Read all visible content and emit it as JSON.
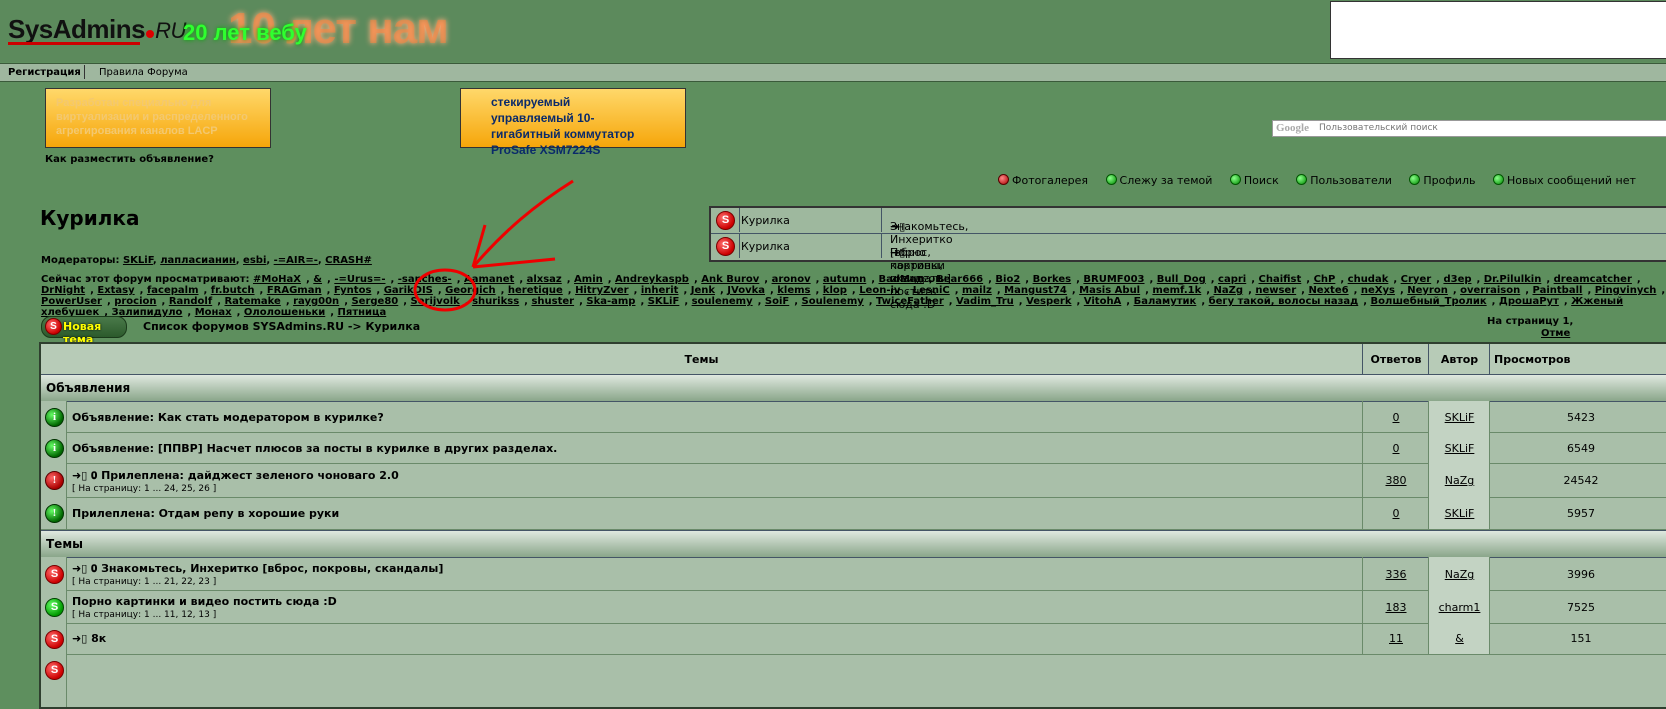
{
  "header": {
    "logo_main": "SysAdmins",
    "logo_suffix": "RU",
    "slogan": "20 лет вебу",
    "anniversary": "10 лет нам"
  },
  "topnav": {
    "register": "Регистрация",
    "rules": "Правила Форума"
  },
  "banners": {
    "left_text": "Разработан специально для виртуализации и распределенного агрегирования каналов LACP",
    "right_text": "стекируемый управляемый 10-гигабитный коммутатор ProSafe XSM7224S",
    "ad_link": "Как разместить объявление?"
  },
  "search": {
    "brand": "Google",
    "placeholder": "Пользовательский поиск"
  },
  "quicklinks": [
    "Фотогалерея",
    "Слежу за темой",
    "Поиск",
    "Пользователи",
    "Профиль",
    "Новых сообщений нет"
  ],
  "forum_title": "Курилка",
  "mini_topics": [
    {
      "forum": "Курилка",
      "title": "Знакомьтесь, Инхеритко [вброс, покровы, скандалы]"
    },
    {
      "forum": "Курилка",
      "title": "Порно картинки и видео постить сюда :D"
    }
  ],
  "moderators": {
    "label": "Модераторы:",
    "names": [
      "SKLiF",
      "лапласианин",
      "esbi",
      "-=AIR=-",
      "CRASH#"
    ]
  },
  "viewers": {
    "label": "Сейчас этот форум просматривают:",
    "names": [
      "#MoHaX",
      "&",
      "-=Urus=-",
      "-sanches-",
      "Aamanet",
      "alxsaz",
      "Amin",
      "Andreykaspb",
      "Ank Burov",
      "aronov",
      "autumn",
      "BadMan",
      "Bear666",
      "Bio2",
      "Borkes",
      "BRUMF003",
      "Bull_Dog",
      "capri",
      "Chaifist",
      "ChP",
      "chudak",
      "Cryer",
      "d3ep",
      "Dr.Pilulkin",
      "dreamcatcher",
      "DrNight",
      "Extasy",
      "facepalm",
      "fr.butch",
      "FRAGman",
      "Fyntos",
      "GarikDIS",
      "Georgich",
      "heretique",
      "HitryZver",
      "inherit",
      "Jenk",
      "JVovka",
      "klems",
      "klop",
      "Leon-iv",
      "LesniC",
      "mailz",
      "Mangust74",
      "Masis Abul",
      "memf.1k",
      "NaZg",
      "newser",
      "Nexte6",
      "neXys",
      "Neyron",
      "overraison",
      "Paintball",
      "Pingvinych",
      "PowerUser",
      "procion",
      "Randolf",
      "Ratemake",
      "rayg00n",
      "Serge80",
      "Serijvolk",
      "shurikss",
      "shuster",
      "Ska-amp",
      "SKLiF",
      "soulenemy",
      "SoiF",
      "Soulenemy",
      "TwiceFather",
      "Vadim_Tru",
      "Vesperk",
      "VitohA",
      "Баламутик",
      "бегу такой, волосы назад",
      "Волшебный_Тролик",
      "ДрошаРут",
      "Жженый хлебушек",
      "Залипидуло",
      "Монах",
      "Ололошеньки",
      "Пятница"
    ]
  },
  "toolbar": {
    "new_topic": "Новая тема",
    "breadcrumb": "Список форумов SYSAdmins.RU -> Курилка",
    "pages": "На страницу 1,",
    "mark_read": "Отме"
  },
  "table": {
    "headers": {
      "topics": "Темы",
      "replies": "Ответов",
      "author": "Автор",
      "views": "Просмотров"
    },
    "section_announcements": "Объявления",
    "section_topics": "Темы",
    "rows": [
      {
        "title": "Объявление: Как стать модератором в курилке?",
        "pages": "",
        "replies": "0",
        "author": "SKLiF",
        "views": "5423"
      },
      {
        "title": "Объявление: [ППВР] Насчет плюсов за посты в курилке в других разделах.",
        "pages": "",
        "replies": "0",
        "author": "SKLiF",
        "views": "6549"
      },
      {
        "title": "Прилеплена: дайджест зеленого чоноваго 2.0",
        "pages": "[ На страницу: 1 ... 24, 25, 26 ]",
        "replies": "380",
        "author": "NaZg",
        "views": "24542"
      },
      {
        "title": "Прилеплена: Отдам репу в хорошие руки",
        "pages": "",
        "replies": "0",
        "author": "SKLiF",
        "views": "5957"
      },
      {
        "title": "Знакомьтесь, Инхеритко [вброс, покровы, скандалы]",
        "pages": "[ На страницу: 1 ... 21, 22, 23 ]",
        "replies": "336",
        "author": "NaZg",
        "views": "3996"
      },
      {
        "title": "Порно картинки и видео постить сюда :D",
        "pages": "[ На страницу: 1 ... 11, 12, 13 ]",
        "replies": "183",
        "author": "charm1",
        "views": "7525"
      },
      {
        "title": "8к",
        "pages": "",
        "replies": "11",
        "author": "&",
        "views": "151"
      }
    ]
  }
}
